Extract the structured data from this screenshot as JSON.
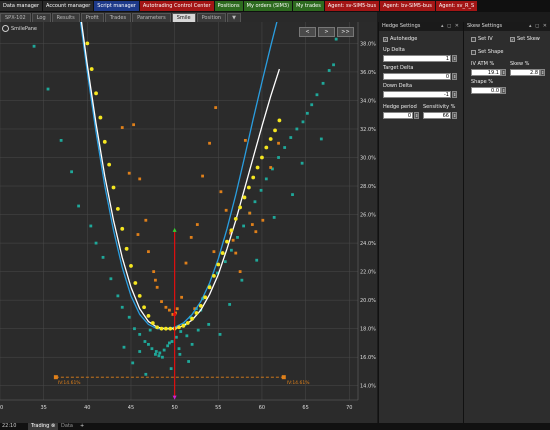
{
  "app_tabs": [
    {
      "label": "Data manager",
      "bg": "#2a2a2a"
    },
    {
      "label": "Account manager",
      "bg": "#2a2a2a"
    },
    {
      "label": "Script manager",
      "bg": "#1e3a8a"
    },
    {
      "label": "Autotrading Control Center",
      "bg": "#a31515"
    },
    {
      "label": "Positions",
      "bg": "#2d6a1f"
    },
    {
      "label": "My orders (SIM3)",
      "bg": "#2d6a1f"
    },
    {
      "label": "My trades",
      "bg": "#2d6a1f"
    },
    {
      "label": "Agent: sv-SIM5-bus",
      "bg": "#a31515"
    },
    {
      "label": "Agent: bv-SIM5-bus",
      "bg": "#a31515"
    },
    {
      "label": "Agent: sv_R_S",
      "bg": "#a31515"
    }
  ],
  "sub_tabs": [
    "SPX-102",
    "Log",
    "Results",
    "Profit",
    "Trades",
    "Parameters",
    "Smile",
    "Position",
    "▼"
  ],
  "active_sub_tab": "Smile",
  "chart_controls": [
    "<",
    ">",
    ">>"
  ],
  "chart_data": {
    "type": "scatter",
    "legend": [
      "SmilePane"
    ],
    "x_ticks": [
      30,
      35,
      40,
      45,
      50,
      55,
      60,
      65,
      70
    ],
    "y_ticks": [
      "14.0%",
      "16.0%",
      "18.0%",
      "20.0%",
      "22.0%",
      "24.0%",
      "26.0%",
      "28.0%",
      "30.0%",
      "32.0%",
      "34.0%",
      "36.0%",
      "38.0%"
    ],
    "xlim": [
      30,
      71
    ],
    "ylim": [
      13.0,
      39.5
    ],
    "colors": {
      "teal": "#1fa89a",
      "orange": "#e0801a",
      "yellow": "#f5e620",
      "white": "#ffffff",
      "blue": "#2a9ee0",
      "red": "#e01010",
      "green": "#30d030",
      "magenta": "#d020d0"
    },
    "series": [
      {
        "style": "white-line",
        "x": [
          39.0,
          40.0,
          41.0,
          42.0,
          43.0,
          44.0,
          45.0,
          46.0,
          47.0,
          48.0,
          49.0,
          50.0,
          51.0,
          52.0,
          53.0,
          54.0,
          55.0,
          56.0,
          57.0,
          58.0,
          59.0,
          60.0,
          61.0,
          62.0
        ],
        "y": [
          41.0,
          36.5,
          32.4,
          28.7,
          25.6,
          23.0,
          20.9,
          19.4,
          18.5,
          18.1,
          18.0,
          18.0,
          18.2,
          18.6,
          19.3,
          20.4,
          21.8,
          23.6,
          25.6,
          27.8,
          30.0,
          32.2,
          34.3,
          36.2
        ]
      },
      {
        "style": "blue-line",
        "x": [
          39.0,
          40.0,
          41.0,
          42.0,
          43.0,
          44.0,
          45.0,
          46.0,
          47.0,
          48.0,
          49.0,
          50.0,
          51.0,
          52.0,
          53.0,
          54.0,
          55.0,
          56.0,
          57.0,
          58.0,
          59.0,
          60.0,
          61.0,
          62.0,
          63.0
        ],
        "y": [
          40.5,
          36.0,
          31.8,
          28.0,
          24.9,
          22.3,
          20.3,
          19.0,
          18.3,
          18.0,
          18.0,
          18.1,
          18.4,
          19.0,
          19.9,
          21.2,
          22.9,
          25.0,
          27.4,
          30.0,
          32.7,
          35.3,
          37.8,
          40.2,
          42.4
        ]
      },
      {
        "style": "yellow-dots",
        "x": [
          40.0,
          40.5,
          41.0,
          41.5,
          42.0,
          42.5,
          43.0,
          43.5,
          44.0,
          44.5,
          45.0,
          45.5,
          46.0,
          46.5,
          47.0,
          47.5,
          48.0,
          48.5,
          49.0,
          49.5,
          50.0,
          50.5,
          51.0,
          51.5,
          52.0,
          52.5,
          53.0,
          53.5,
          54.0,
          54.5,
          55.0,
          55.5,
          56.0,
          56.5,
          57.0,
          57.5,
          58.0,
          58.5,
          59.0,
          59.5,
          60.0,
          60.5,
          61.0,
          61.5,
          62.0
        ],
        "y": [
          38.0,
          36.2,
          34.5,
          32.8,
          31.1,
          29.5,
          27.9,
          26.4,
          25.0,
          23.6,
          22.4,
          21.2,
          20.3,
          19.5,
          18.9,
          18.4,
          18.1,
          18.0,
          18.0,
          18.0,
          18.0,
          18.1,
          18.2,
          18.4,
          18.7,
          19.1,
          19.6,
          20.2,
          20.9,
          21.7,
          22.5,
          23.3,
          24.1,
          24.9,
          25.7,
          26.5,
          27.2,
          27.9,
          28.6,
          29.3,
          30.0,
          30.7,
          31.3,
          31.9,
          32.6
        ]
      },
      {
        "style": "teal-points",
        "x": [
          33.9,
          35.5,
          37.0,
          38.2,
          39.0,
          40.4,
          41.0,
          41.8,
          42.7,
          43.5,
          44.0,
          44.8,
          45.4,
          46.0,
          46.6,
          47.0,
          47.4,
          47.9,
          48.3,
          48.8,
          49.2,
          49.7,
          50.2,
          50.7,
          51.2,
          51.8,
          52.5,
          53.2,
          54.0,
          54.9,
          55.8,
          56.5,
          57.2,
          57.9,
          58.6,
          59.2,
          59.9,
          60.5,
          61.2,
          61.9,
          62.6,
          63.3,
          64.0,
          64.7,
          65.2,
          65.7,
          66.3,
          67.0,
          67.7,
          68.5,
          44.2,
          45.2,
          46.7,
          47.8,
          48.6,
          49.6,
          50.5,
          51.6,
          52.7,
          53.9,
          55.2,
          56.3,
          57.7,
          59.4,
          61.4,
          63.5,
          64.6,
          66.8,
          68.2,
          69.5,
          46.0,
          47.2,
          48.2,
          49.4,
          50.6,
          51.4,
          52.0,
          53.0
        ],
        "y": [
          37.8,
          34.8,
          31.2,
          29.0,
          26.6,
          25.2,
          24.0,
          23.0,
          21.5,
          20.3,
          19.5,
          18.8,
          18.0,
          17.6,
          17.1,
          16.9,
          16.6,
          16.4,
          16.3,
          16.5,
          16.8,
          17.1,
          17.4,
          17.8,
          18.3,
          18.8,
          19.4,
          20.1,
          21.0,
          21.9,
          22.7,
          23.5,
          24.4,
          25.2,
          26.1,
          26.9,
          27.7,
          28.5,
          29.2,
          30.0,
          30.7,
          31.4,
          32.0,
          32.5,
          33.1,
          33.7,
          34.4,
          35.2,
          36.1,
          38.3,
          16.7,
          15.6,
          14.8,
          16.2,
          16.0,
          15.2,
          16.6,
          15.7,
          17.9,
          18.3,
          17.6,
          19.7,
          21.4,
          22.8,
          25.8,
          27.4,
          29.6,
          31.3,
          36.5,
          39.0,
          16.4,
          17.9,
          16.1,
          17.0,
          16.2,
          17.5,
          16.9,
          19.3
        ]
      },
      {
        "style": "orange-points",
        "x": [
          44.0,
          44.8,
          45.3,
          46.0,
          46.7,
          47.0,
          47.6,
          48.0,
          48.5,
          49.0,
          49.4,
          49.8,
          50.3,
          50.8,
          51.3,
          51.9,
          52.6,
          53.2,
          54.0,
          54.7,
          55.3,
          55.9,
          56.4,
          57.0,
          57.5,
          58.1,
          58.6,
          59.3,
          60.1,
          61.0,
          61.9,
          45.8,
          47.8,
          50.1,
          52.3,
          54.5,
          56.7,
          58.9
        ],
        "y": [
          32.1,
          28.9,
          32.3,
          28.5,
          25.6,
          23.4,
          22.0,
          20.9,
          19.9,
          19.5,
          19.3,
          19.0,
          19.4,
          20.2,
          22.6,
          24.4,
          25.3,
          28.7,
          31.0,
          33.5,
          27.6,
          26.3,
          24.7,
          23.3,
          22.0,
          31.2,
          26.1,
          24.8,
          25.6,
          29.3,
          31.0,
          24.6,
          21.4,
          19.1,
          19.4,
          23.4,
          24.2,
          25.3
        ]
      },
      {
        "style": "red-marker",
        "x": [
          50.0
        ],
        "y": [
          19.0
        ]
      }
    ],
    "atm_line": {
      "x": 50.0,
      "y_from": 13.1,
      "y_to": 25.0
    },
    "hline": {
      "y": 14.6,
      "x_from": 36.4,
      "x_to": 62.5
    },
    "annotations": [
      "IV:14.61%",
      "IV:14.61%"
    ]
  },
  "hedge_panel": {
    "title": "Hedge Settings",
    "autohedge_label": "Autohedge",
    "up_delta_label": "Up Delta",
    "up_delta_value": "1",
    "target_delta_label": "Target Delta",
    "target_delta_value": "0",
    "down_delta_label": "Down Delta",
    "down_delta_value": "-1",
    "hedge_period_label": "Hedge period",
    "hedge_period_value": "0",
    "sensitivity_label": "Sensitivity %",
    "sensitivity_value": "66"
  },
  "skew_panel": {
    "title": "Skew Settings",
    "set_iv_label": "Set IV",
    "set_skew_label": "Set Skew",
    "set_shape_label": "Set Shape",
    "iv_atm_label": "IV ATM %",
    "iv_atm_value": "19.1",
    "skew_label": "Skew %",
    "skew_value": "2.8",
    "shape_label": "Shape %",
    "shape_value": "0.0"
  },
  "status_bar": {
    "time": "22:10",
    "tab_trading": "Trading",
    "tab_data": "Data",
    "plus": "+"
  }
}
